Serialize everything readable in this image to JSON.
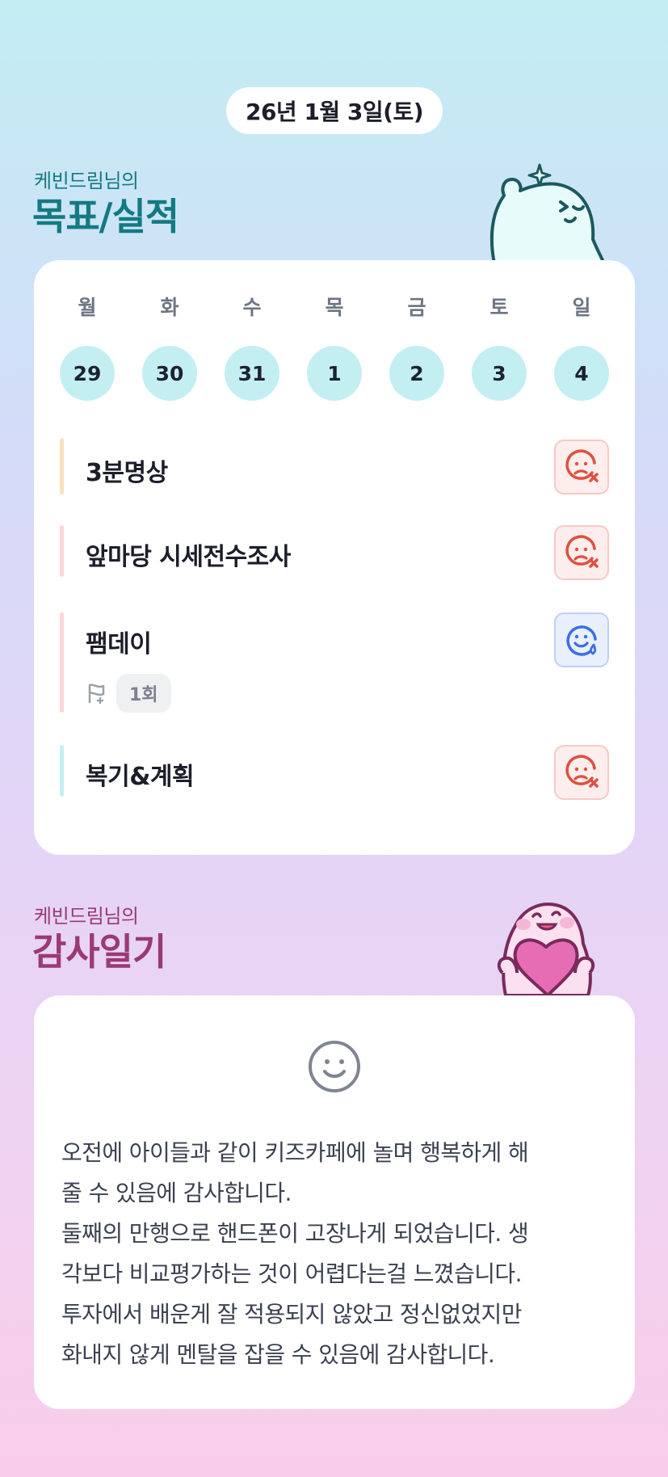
{
  "header": {
    "date": "26년 1월 3일(토)"
  },
  "goals_section": {
    "subtitle": "케빈드림님의",
    "title": "목표/실적",
    "week": [
      {
        "day": "월",
        "date": "29"
      },
      {
        "day": "화",
        "date": "30"
      },
      {
        "day": "수",
        "date": "31"
      },
      {
        "day": "목",
        "date": "1"
      },
      {
        "day": "금",
        "date": "2"
      },
      {
        "day": "토",
        "date": "3"
      },
      {
        "day": "일",
        "date": "4"
      }
    ],
    "goals": [
      {
        "title": "3분명상",
        "status": "fail",
        "bar_color": "#fbe0bd",
        "status_icon": "sad-x-icon"
      },
      {
        "title": "앞마당 시세전수조사",
        "status": "fail",
        "bar_color": "#fbd6d9",
        "status_icon": "sad-x-icon"
      },
      {
        "title": "팸데이",
        "status": "ok",
        "bar_color": "#fbd6d9",
        "status_icon": "smile-drop-icon",
        "streak": "1회",
        "streak_icon": "flag-icon"
      },
      {
        "title": "복기&계획",
        "status": "fail",
        "bar_color": "#c4eff2",
        "status_icon": "sad-x-icon"
      }
    ]
  },
  "gratitude_section": {
    "subtitle": "케빈드림님의",
    "title": "감사일기",
    "mood_icon": "smile-face-icon",
    "lines": [
      "오전에 아이들과 같이 키즈카페에 놀며 행복하게 해",
      "줄 수 있음에 감사합니다.",
      "둘째의 만행으로 핸드폰이 고장나게 되었습니다. 생",
      "각보다 비교평가하는 것이 어렵다는걸 느꼈습니다.",
      "투자에서 배운게 잘 적용되지 않았고 정신없었지만",
      "화내지 않게 멘탈을 잡을 수 있음에 감사합니다."
    ]
  },
  "colors": {
    "teal": "#147a82",
    "plum": "#9b3a72",
    "fail": "#e0503f",
    "ok": "#3a6ee8"
  }
}
